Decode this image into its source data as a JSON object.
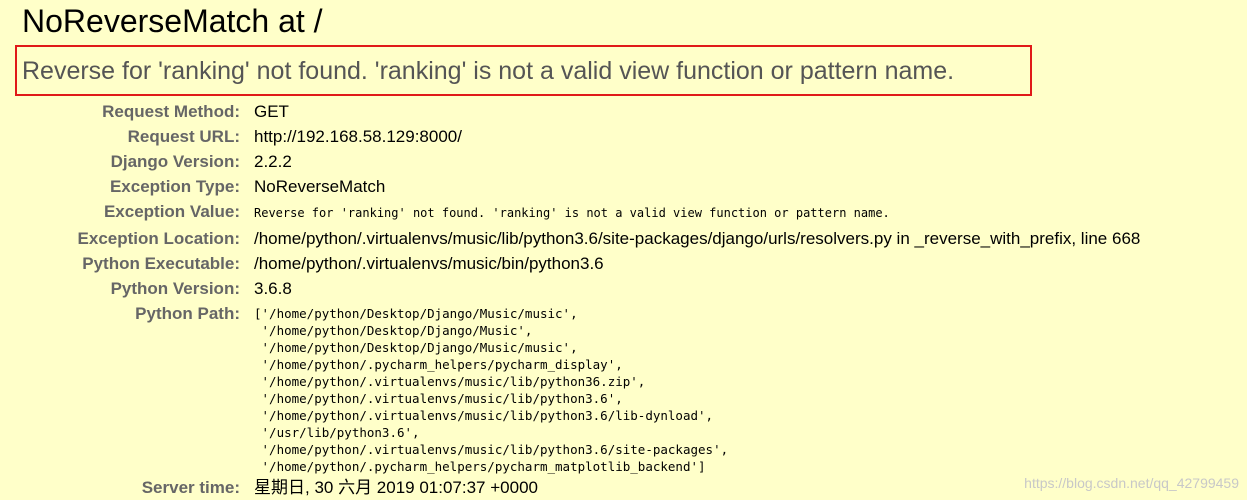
{
  "summary": {
    "title": "NoReverseMatch at /",
    "exception_value": "Reverse for 'ranking' not found. 'ranking' is not a valid view function or pattern name."
  },
  "meta": {
    "request_method": {
      "label": "Request Method:",
      "value": "GET"
    },
    "request_url": {
      "label": "Request URL:",
      "value": "http://192.168.58.129:8000/"
    },
    "django_version": {
      "label": "Django Version:",
      "value": "2.2.2"
    },
    "exception_type": {
      "label": "Exception Type:",
      "value": "NoReverseMatch"
    },
    "exception_value": {
      "label": "Exception Value:",
      "value": "Reverse for 'ranking' not found. 'ranking' is not a valid view function or pattern name."
    },
    "exception_location": {
      "label": "Exception Location:",
      "value": "/home/python/.virtualenvs/music/lib/python3.6/site-packages/django/urls/resolvers.py in _reverse_with_prefix, line 668"
    },
    "python_executable": {
      "label": "Python Executable:",
      "value": "/home/python/.virtualenvs/music/bin/python3.6"
    },
    "python_version": {
      "label": "Python Version:",
      "value": "3.6.8"
    },
    "python_path": {
      "label": "Python Path:",
      "lines": [
        "['/home/python/Desktop/Django/Music/music',",
        " '/home/python/Desktop/Django/Music',",
        " '/home/python/Desktop/Django/Music/music',",
        " '/home/python/.pycharm_helpers/pycharm_display',",
        " '/home/python/.virtualenvs/music/lib/python36.zip',",
        " '/home/python/.virtualenvs/music/lib/python3.6',",
        " '/home/python/.virtualenvs/music/lib/python3.6/lib-dynload',",
        " '/usr/lib/python3.6',",
        " '/home/python/.virtualenvs/music/lib/python3.6/site-packages',",
        " '/home/python/.pycharm_helpers/pycharm_matplotlib_backend']"
      ]
    },
    "server_time": {
      "label": "Server time:",
      "value": "星期日, 30 六月 2019 01:07:37 +0000"
    }
  },
  "watermark": "https://blog.csdn.net/qq_42799459",
  "colors": {
    "background": "#ffffc9",
    "highlight_border": "#e01919",
    "label": "#666666",
    "exception_value_text": "#555555"
  }
}
